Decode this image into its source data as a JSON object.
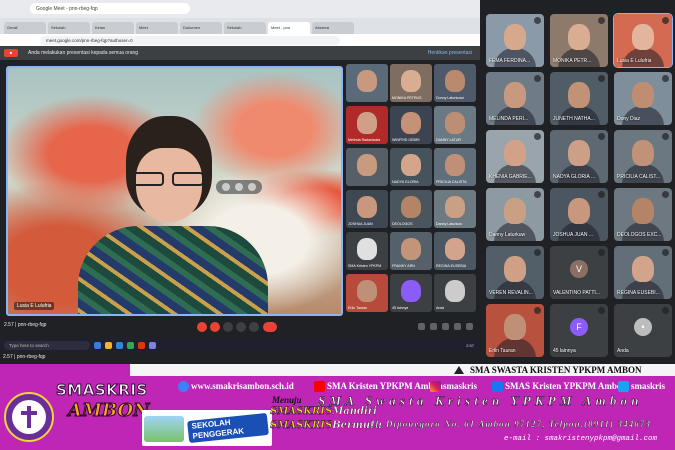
{
  "browser": {
    "app_tab": "Google Meet - pnn-rbeg-fqp",
    "tabs": [
      "Gmail",
      "Sekolah",
      "Kelas",
      "Meet",
      "Dokumen",
      "Sekolah",
      "Meet - pnn",
      "Absensi"
    ],
    "url": "meet.google.com/pnn-rbeg-fqp?authuser=0",
    "presenting_msg": "Anda melakukan presentasi kepada semua orang",
    "stop_sharing": "Hentikan presentasi"
  },
  "meeting": {
    "code": "pnn-rbeg-fqp",
    "time": "2.57",
    "presenter_name": "Lusia E Lulufria",
    "search_placeholder": "Type here to search",
    "clock": "2.57"
  },
  "inner_grid": [
    {
      "name": "",
      "skin": "#c79a80",
      "bg": "#5a6a78"
    },
    {
      "name": "MONIKA PETRUS",
      "skin": "#d9ad92",
      "bg": "#7e6d60"
    },
    {
      "name": "Donny Laturkuwe",
      "skin": "#b98a6e",
      "bg": "#4e5a6a"
    },
    {
      "name": "Melinda Radasiwala",
      "skin": "#cfa087",
      "bg": "#b02a2a"
    },
    {
      "name": "WINFRID GEBRI",
      "skin": "#c39277",
      "bg": "#3b4450"
    },
    {
      "name": "DANNY LATUR",
      "skin": "#bc8f74",
      "bg": "#6a7a84"
    },
    {
      "name": "",
      "skin": "#c89b7f",
      "bg": "#565f68"
    },
    {
      "name": "NADYA GLORIA",
      "skin": "#d3a58a",
      "bg": "#46525c"
    },
    {
      "name": "PRICILIA CALISTA",
      "skin": "#bf9077",
      "bg": "#5e6e7a"
    },
    {
      "name": "JOSHUA JUAN",
      "skin": "#c8987e",
      "bg": "#3f4852"
    },
    {
      "name": "DEOLOGOS",
      "skin": "#b38566",
      "bg": "#4a555e"
    },
    {
      "name": "Danny Laturkuw",
      "skin": "#caa085",
      "bg": "#6d7a82"
    },
    {
      "name": "SMA Kristen YPKPM",
      "skin": "#e0e0e0",
      "bg": "#3c4043"
    },
    {
      "name": "FRANKY ARN",
      "skin": "#c29478",
      "bg": "#55606a"
    },
    {
      "name": "REGINA EUSEBIA",
      "skin": "#d2a48b",
      "bg": "#4b5762"
    },
    {
      "name": "Erlin Tauran",
      "skin": "#c09076",
      "bg": "#b74a3a"
    },
    {
      "name": "45 lainnya",
      "skin": "#8b5cf6",
      "bg": "#3c4043"
    },
    {
      "name": "Anda",
      "skin": "#cccccc",
      "bg": "#3c4043"
    }
  ],
  "grid": [
    {
      "name": "FEMA FERDINA...",
      "skin": "#d6a88c",
      "bg": "#8a9aa8",
      "kind": "face"
    },
    {
      "name": "MONIKA PETR...",
      "skin": "#d9ad92",
      "bg": "#8d7a6a",
      "kind": "face"
    },
    {
      "name": "Lusia E Lulufria",
      "skin": "#e3b59c",
      "bg": "#d46a52",
      "kind": "face"
    },
    {
      "name": "MELINDA PERI...",
      "skin": "#c9997f",
      "bg": "#6f7c88",
      "kind": "face"
    },
    {
      "name": "JUNETH NATHA...",
      "skin": "#c29276",
      "bg": "#505c66",
      "kind": "face"
    },
    {
      "name": "Dony Diaz",
      "skin": "#bf8e72",
      "bg": "#7e8e9a",
      "kind": "face"
    },
    {
      "name": "KHENIA GABRIE...",
      "skin": "#d1a287",
      "bg": "#9aa4ac",
      "kind": "face"
    },
    {
      "name": "NADYA GLORIA ...",
      "skin": "#cca086",
      "bg": "#5d6872",
      "kind": "face"
    },
    {
      "name": "PRICILIA CALIST...",
      "skin": "#c09278",
      "bg": "#6b7882",
      "kind": "face"
    },
    {
      "name": "Danny Laturkuw",
      "skin": "#caa085",
      "bg": "#8e9aa2",
      "kind": "face"
    },
    {
      "name": "JOSHUA JUAN ...",
      "skin": "#c8987e",
      "bg": "#4c5660",
      "kind": "face"
    },
    {
      "name": "DEOLOGOS EXC...",
      "skin": "#b38566",
      "bg": "#6e7880",
      "kind": "face"
    },
    {
      "name": "VEREN REVALIN...",
      "skin": "#cfa085",
      "bg": "#525e68",
      "kind": "face"
    },
    {
      "name": "VALENTINO PATTI...",
      "skin": "#8d6e63",
      "bg": "#3c4043",
      "kind": "avatar",
      "letter": "V"
    },
    {
      "name": "REGINA EUSEBI...",
      "skin": "#d2a48b",
      "bg": "#626e78",
      "kind": "face"
    },
    {
      "name": "Erlin Tauran",
      "skin": "#c09076",
      "bg": "#b8523e",
      "kind": "face"
    },
    {
      "name": "45 lainnya",
      "skin": "#8b5cf6",
      "bg": "#3c4043",
      "kind": "more",
      "letter": "F"
    },
    {
      "name": "Anda",
      "skin": "#bdbdbd",
      "bg": "#3c4043",
      "kind": "avatar",
      "letter": "•"
    }
  ],
  "banner": {
    "top_name": "SMA SWASTA KRISTEN YPKPM AMBON",
    "brand_line1": "SMASKRIS",
    "brand_line2": "AMBON",
    "badge_text": "SEKOLAH PENGGERAK",
    "website": "www.smakrisambon.sch.id",
    "youtube": "SMA Kristen YPKPM Ambon",
    "instagram": "smaskris",
    "facebook": "SMAS Kristen YPKPM Ambon",
    "other": "smaskris",
    "menuju": "Menuju",
    "school_big": "SMA Swasta Kristen YPKPM Ambon",
    "motto1_a": "SMASKRIS",
    "motto1_b": "Mandiri",
    "motto2_a": "SMASKRIS",
    "motto2_b": "Bermutu",
    "address": "Jl. Diponegoro No. 61 Ambon 97127, Telpon.(0911) 344673",
    "email": "e-mail : smakristenypkpm@gmail.com"
  },
  "colors": {
    "meet_bg": "#202124",
    "accent": "#8ab4f8",
    "banner_bg": "#c026b6",
    "end_call": "#ea4335"
  }
}
